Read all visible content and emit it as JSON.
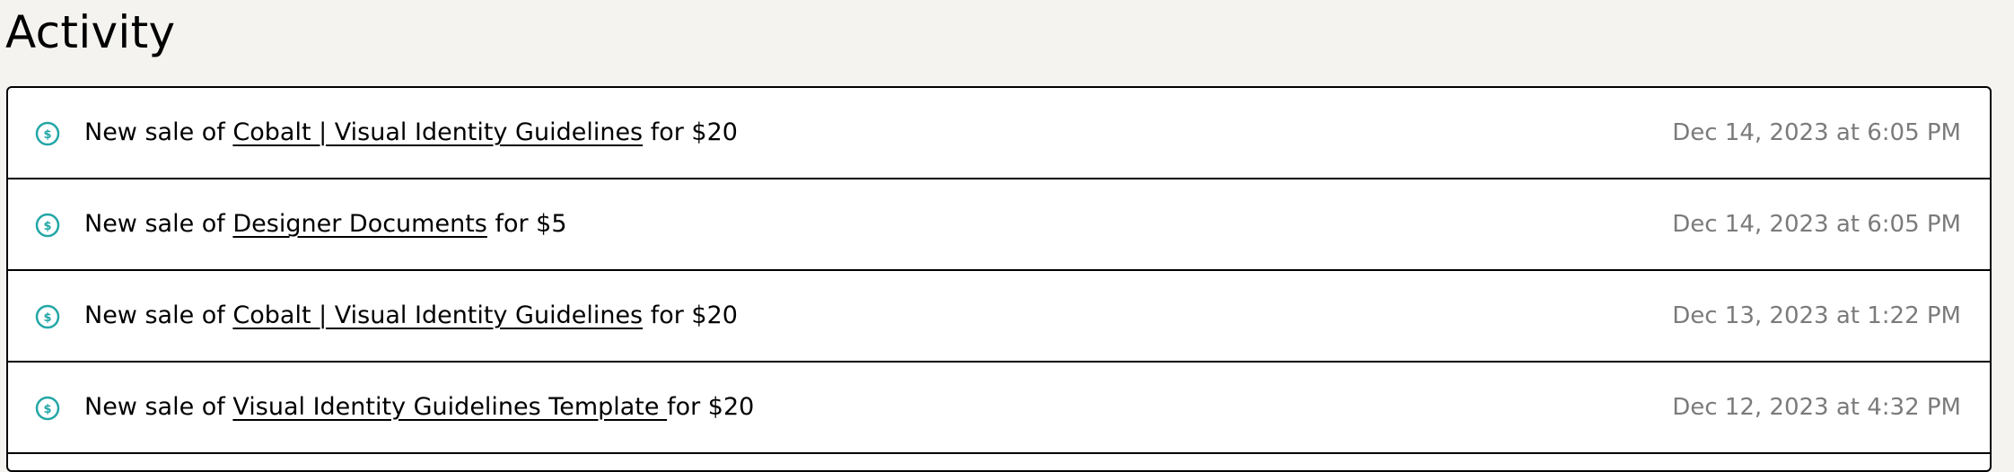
{
  "page": {
    "title": "Activity"
  },
  "colors": {
    "background": "#f4f3f0",
    "card": "#ffffff",
    "border": "#000000",
    "icon": "#23a6a6",
    "date": "#7b7b7b"
  },
  "activity": {
    "items": [
      {
        "icon": "dollar-circle-icon",
        "prefix": "New sale of ",
        "product": "Cobalt | Visual Identity Guidelines",
        "suffix": " for $20",
        "date": "Dec 14, 2023 at 6:05 PM"
      },
      {
        "icon": "dollar-circle-icon",
        "prefix": "New sale of ",
        "product": "Designer Documents",
        "suffix": " for $5",
        "date": "Dec 14, 2023 at 6:05 PM"
      },
      {
        "icon": "dollar-circle-icon",
        "prefix": "New sale of ",
        "product": "Cobalt | Visual Identity Guidelines",
        "suffix": " for $20",
        "date": "Dec 13, 2023 at 1:22 PM"
      },
      {
        "icon": "dollar-circle-icon",
        "prefix": "New sale of ",
        "product": "Visual Identity Guidelines Template ",
        "suffix": "for $20",
        "date": "Dec 12, 2023 at 4:32 PM"
      }
    ]
  }
}
